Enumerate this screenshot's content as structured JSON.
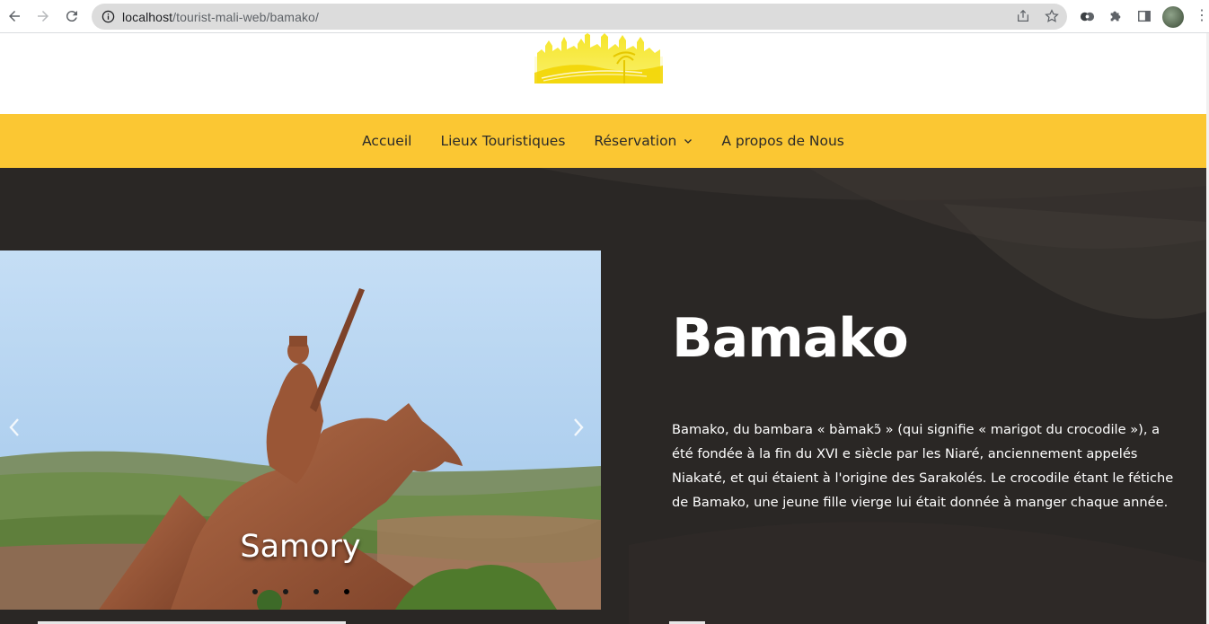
{
  "browser": {
    "url_host": "localhost",
    "url_path": "/tourist-mali-web/bamako/",
    "icons": {
      "back": "back-arrow-icon",
      "forward": "forward-arrow-icon",
      "reload": "reload-icon",
      "site_info": "info-icon",
      "share": "share-icon",
      "bookmark": "star-icon",
      "extension1": "extension-icon",
      "puzzle": "puzzle-icon",
      "sidepanel": "side-panel-icon",
      "menu": "kebab-menu-icon"
    }
  },
  "nav": {
    "items": [
      {
        "label": "Accueil"
      },
      {
        "label": "Lieux Touristiques"
      },
      {
        "label": "Réservation",
        "has_dropdown": true
      },
      {
        "label": "A propos de Nous"
      }
    ]
  },
  "slider": {
    "caption": "Samory",
    "dots": 4
  },
  "content": {
    "title": "Bamako",
    "paragraph": "Bamako, du bambara « bàmakɔ̃ » (qui signifie « marigot du crocodile »), a été fondée à la fin du XVI e siècle par les Niaré, anciennement appelés Niakaté, et qui étaient à l'origine des Sarakolés. Le crocodile étant le fétiche de Bamako, une jeune fille vierge lui était donnée à manger chaque année."
  },
  "colors": {
    "navbar": "#fbc733",
    "hero_bg": "#2a2725",
    "logo": "#f5e21a"
  }
}
